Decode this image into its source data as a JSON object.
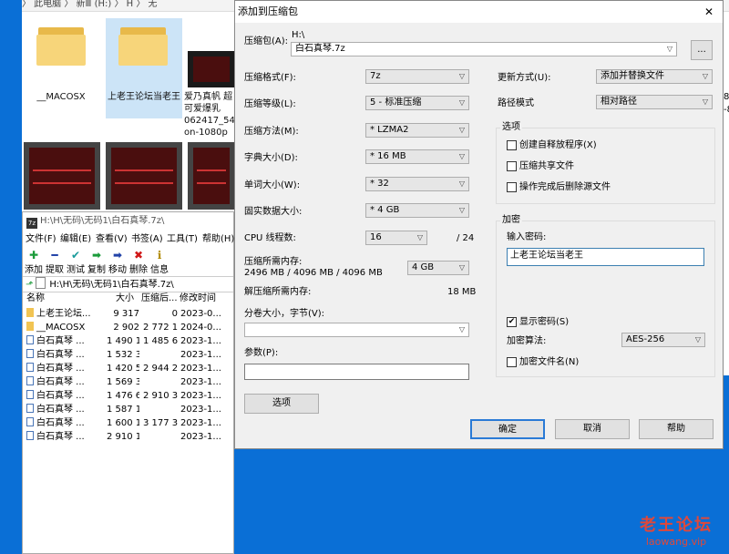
{
  "explorer": {
    "crumb": "〉 此电脑 〉 新Ⅲ (H:) 〉 H 〉 无",
    "folders": [
      {
        "label": "__MACOSX"
      },
      {
        "label": "上老王论坛当老王"
      }
    ],
    "video_caption": [
      "爱乃真帆 超",
      "可爱爆乳",
      "062417_54",
      "on-1080p"
    ],
    "right_edge_text": [
      "8",
      "-8"
    ]
  },
  "file_manager": {
    "title": "H:\\H\\无码\\无码1\\白石真琴.7z\\",
    "menu": [
      "文件(F)",
      "编辑(E)",
      "查看(V)",
      "书签(A)",
      "工具(T)",
      "帮助(H)"
    ],
    "toolbar": [
      {
        "label": "添加",
        "icon": "plus-icon",
        "color": "#1a9b3a"
      },
      {
        "label": "提取",
        "icon": "minus-icon",
        "color": "#2243a8"
      },
      {
        "label": "测试",
        "icon": "check-icon",
        "color": "#1a9b9b"
      },
      {
        "label": "复制",
        "icon": "copy-arrow-icon",
        "color": "#1a9b3a"
      },
      {
        "label": "移动",
        "icon": "move-arrow-icon",
        "color": "#2243a8"
      },
      {
        "label": "删除",
        "icon": "delete-x-icon",
        "color": "#d01818"
      },
      {
        "label": "信息",
        "icon": "info-icon",
        "color": "#b08a00"
      }
    ],
    "address": "H:\\H\\无码\\无码1\\白石真琴.7z\\",
    "columns": [
      "名称",
      "大小",
      "压缩后...",
      "修改时间"
    ],
    "rows": [
      {
        "name": "上老王论坛...",
        "size": "9 317",
        "packed": "0",
        "modified": "2023-0...",
        "type": "folder"
      },
      {
        "name": "__MACOSX",
        "size": "2 902",
        "packed": "2 772 1...",
        "modified": "2024-0...",
        "type": "folder"
      },
      {
        "name": "白石真琴 ...",
        "size": "1 490 1...",
        "packed": "1 485 6...",
        "modified": "2023-1...",
        "type": "file"
      },
      {
        "name": "白石真琴 ...",
        "size": "1 532 3...",
        "packed": "",
        "modified": "2023-1...",
        "type": "file"
      },
      {
        "name": "白石真琴 ...",
        "size": "1 420 5...",
        "packed": "2 944 2...",
        "modified": "2023-1...",
        "type": "file"
      },
      {
        "name": "白石真琴 ...",
        "size": "1 569 3...",
        "packed": "",
        "modified": "2023-1...",
        "type": "file"
      },
      {
        "name": "白石真琴 ...",
        "size": "1 476 6...",
        "packed": "2 910 3...",
        "modified": "2023-1...",
        "type": "file"
      },
      {
        "name": "白石真琴 ...",
        "size": "1 587 1...",
        "packed": "",
        "modified": "2023-1...",
        "type": "file"
      },
      {
        "name": "白石真琴 ...",
        "size": "1 600 1...",
        "packed": "3 177 3...",
        "modified": "2023-1...",
        "type": "file"
      },
      {
        "name": "白石真琴 ...",
        "size": "2 910 1...",
        "packed": "",
        "modified": "2023-1...",
        "type": "file"
      }
    ]
  },
  "dialog": {
    "title": "添加到压缩包",
    "close": "✕",
    "archive_label": "压缩包(A):",
    "archive_path": "H:\\",
    "archive_name": "白石真琴.7z",
    "browse": "...",
    "format_label": "压缩格式(F):",
    "format": "7z",
    "level_label": "压缩等级(L):",
    "level": "5 - 标准压缩",
    "method_label": "压缩方法(M):",
    "method": "* LZMA2",
    "dict_label": "字典大小(D):",
    "dict": "* 16 MB",
    "word_label": "单词大小(W):",
    "word": "* 32",
    "solid_label": "固实数据大小:",
    "solid": "* 4 GB",
    "threads_label": "CPU 线程数:",
    "threads": "16",
    "threads_total": "/ 24",
    "mem_label": "压缩所需内存:",
    "mem_value": "2496 MB / 4096 MB / 4096 MB",
    "mem_limit": "4 GB",
    "decomp_label": "解压缩所需内存:",
    "decomp_value": "18 MB",
    "split_label": "分卷大小，字节(V):",
    "split_value": "",
    "params_label": "参数(P):",
    "params_value": "",
    "options_button": "选项",
    "update_label": "更新方式(U):",
    "update": "添加并替换文件",
    "path_label": "路径模式",
    "path_mode": "相对路径",
    "options_group": "选项",
    "opt_sfx": "创建自释放程序(X)",
    "opt_shared": "压缩共享文件",
    "opt_delete": "操作完成后删除源文件",
    "enc_group": "加密",
    "pwd_label": "输入密码:",
    "pwd_value": "上老王论坛当老王",
    "show_pwd": "显示密码(S)",
    "show_pwd_checked": "✔",
    "enc_method_label": "加密算法:",
    "enc_method": "AES-256",
    "enc_names": "加密文件名(N)",
    "ok": "确定",
    "cancel": "取消",
    "help": "帮助"
  },
  "watermark": {
    "line1": "老王论坛",
    "line2": "laowang.vip"
  }
}
